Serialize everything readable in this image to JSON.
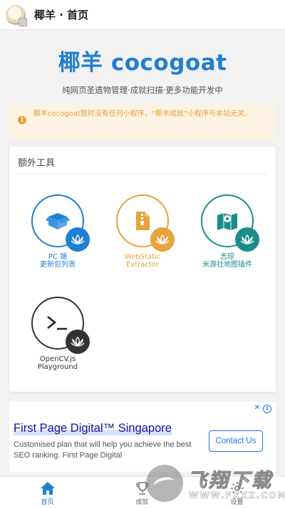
{
  "appbar": {
    "title": "椰羊 · 首页"
  },
  "hero": {
    "title": "椰羊 cocogoat",
    "subtitle": "纯网页圣遗物管理·成就扫描·更多功能开发中"
  },
  "notice": {
    "text": "椰羊cocogoat暂时没有任何小程序，“椰羊成就”小程序与本站无关。"
  },
  "tools_card": {
    "title": "额外工具",
    "items": [
      {
        "line1": "PC 端",
        "line2": "更新包列表",
        "icon": "package-icon",
        "color": "#1f7fd1"
      },
      {
        "line1": "WebStatic",
        "line2": "Extractor",
        "icon": "file-zip-icon",
        "color": "#e6a23c"
      },
      {
        "line1": "志琼",
        "line2": "米游社地图插件",
        "icon": "map-icon",
        "color": "#1a8c8c"
      },
      {
        "line1": "OpenCV.js",
        "line2": "Playground",
        "icon": "terminal-icon",
        "color": "#333333"
      }
    ]
  },
  "ad": {
    "title": "First Page Digital™ Singapore",
    "description": "Customised plan that will help you achieve the best SEO ranking. First Page Digital",
    "button": "Contact Us"
  },
  "tabbar": {
    "tabs": [
      {
        "label": "首页",
        "icon": "home-icon"
      },
      {
        "label": "成就",
        "icon": "trophy-icon"
      },
      {
        "label": "设置",
        "icon": "gear-icon"
      }
    ]
  },
  "watermark": {
    "text": "飞翔下载",
    "url": "WWW.FXXZ.COM"
  },
  "colors": {
    "accent": "#1f7fd1",
    "warning": "#e6a23c",
    "teal": "#1a8c8c",
    "dark": "#333333"
  }
}
